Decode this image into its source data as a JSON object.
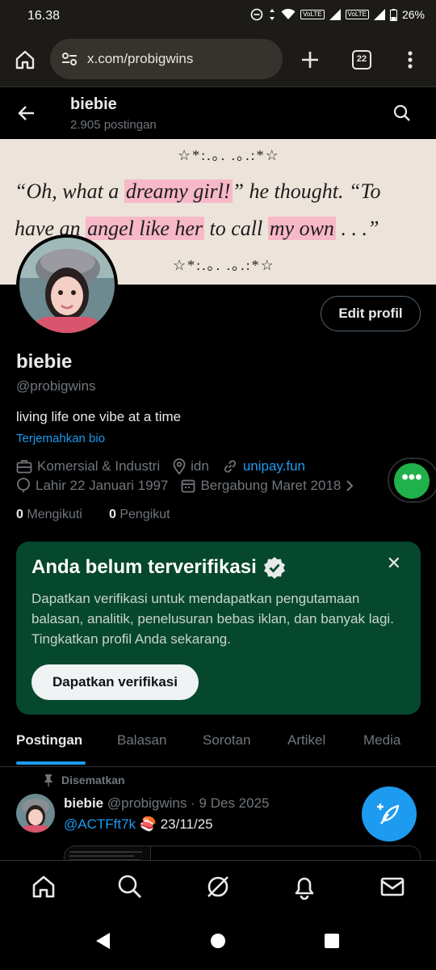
{
  "status_bar": {
    "time": "16.38",
    "volte_1": "VoLTE",
    "volte_2": "VoLTE",
    "battery": "26%"
  },
  "browser": {
    "url": "x.com/probigwins",
    "tab_count": "22"
  },
  "header": {
    "title": "biebie",
    "post_count": "2.905 postingan"
  },
  "banner": {
    "stars_top": "☆*:.｡. .｡.:*☆",
    "line1_a": "“Oh, what a ",
    "line1_hl": "dreamy girl!",
    "line1_b": "” he thought. “To",
    "line2_a": "have an ",
    "line2_hl1": "angel like her",
    "line2_b": " to call ",
    "line2_hl2": "my own",
    "line2_c": " . . .”",
    "stars_bottom": "☆*:.｡. .｡.:*☆"
  },
  "profile": {
    "edit_label": "Edit profil",
    "name": "biebie",
    "handle": "@probigwins",
    "bio": "living life one vibe at a time",
    "translate_bio": "Terjemahkan bio",
    "category": "Komersial & Industri",
    "location": "idn",
    "website": "unipay.fun",
    "birthday": "Lahir 22 Januari 1997",
    "joined": "Bergabung Maret 2018",
    "following_count": "0",
    "following_label": "Mengikuti",
    "followers_count": "0",
    "followers_label": "Pengikut"
  },
  "verification_card": {
    "title": "Anda belum terverifikasi",
    "text": "Dapatkan verifikasi untuk mendapatkan pengutamaan balasan, analitik, penelusuran bebas iklan, dan banyak lagi. Tingkatkan profil Anda sekarang.",
    "button": "Dapatkan verifikasi"
  },
  "tabs": [
    "Postingan",
    "Balasan",
    "Sorotan",
    "Artikel",
    "Media"
  ],
  "pinned_tweet": {
    "pinned_label": "Disematkan",
    "name": "biebie",
    "handle": "@probigwins",
    "dot": "·",
    "date": "9 Des 2025",
    "mention": "@ACTFft7k",
    "emoji": "🍣",
    "text": "23/11/25"
  },
  "colors": {
    "accent": "#1d9bf0",
    "verify_card_bg": "#06482d",
    "more_fab": "#21b14b",
    "banner_highlight": "#f7b8c8"
  },
  "icons": {
    "nav": [
      "home-icon",
      "search-icon",
      "grok-icon",
      "bell-icon",
      "mail-icon"
    ]
  }
}
